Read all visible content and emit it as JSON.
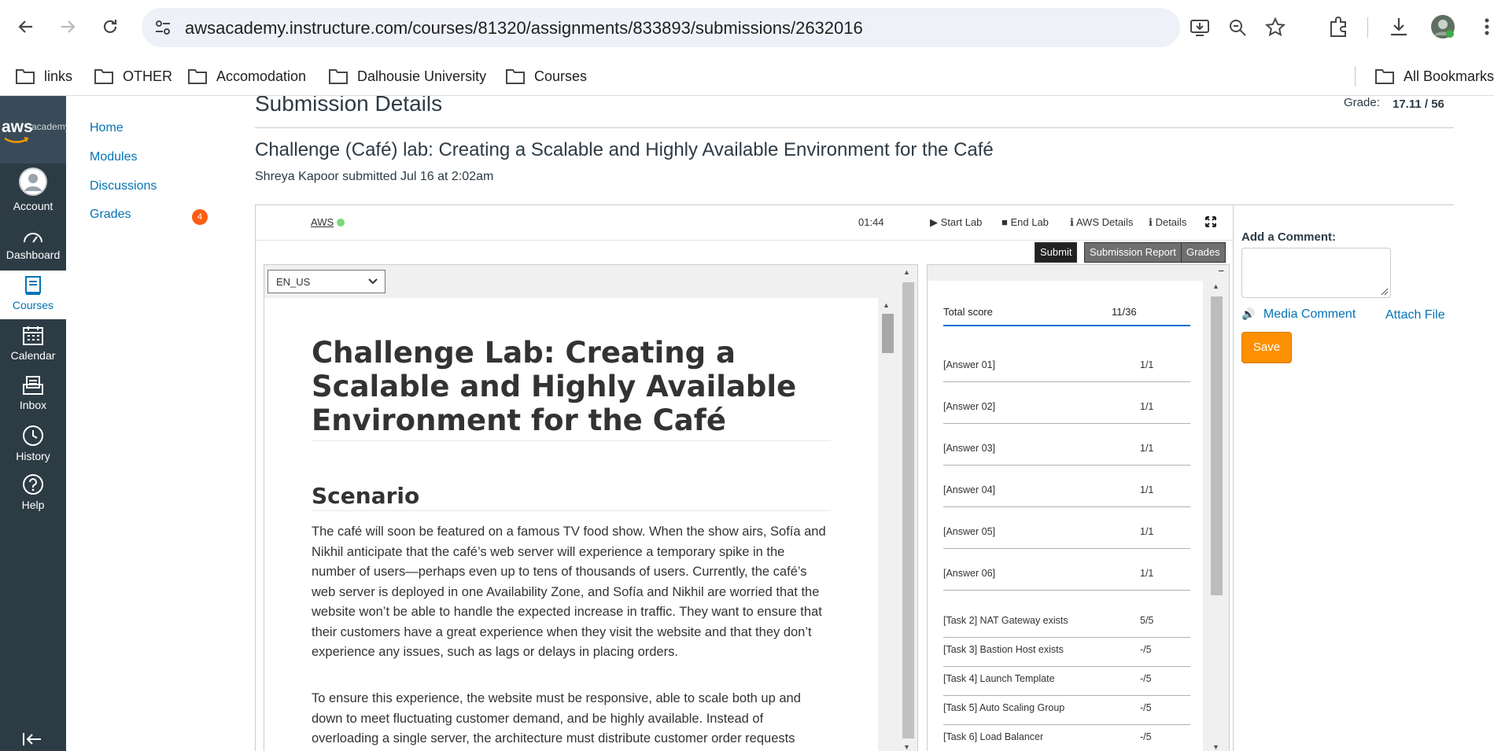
{
  "browser": {
    "url": "awsacademy.instructure.com/courses/81320/assignments/833893/submissions/2632016",
    "bookmarks": [
      "links",
      "OTHER",
      "Accomodation",
      "Dalhousie University",
      "Courses"
    ],
    "all_bookmarks": "All Bookmarks"
  },
  "global_nav": {
    "logo_text": "aws",
    "logo_sub": "academy",
    "items": [
      {
        "label": "Account",
        "icon": "account-icon"
      },
      {
        "label": "Dashboard",
        "icon": "dashboard-icon"
      },
      {
        "label": "Courses",
        "icon": "courses-icon",
        "active": true
      },
      {
        "label": "Calendar",
        "icon": "calendar-icon"
      },
      {
        "label": "Inbox",
        "icon": "inbox-icon"
      },
      {
        "label": "History",
        "icon": "history-icon"
      },
      {
        "label": "Help",
        "icon": "help-icon"
      }
    ]
  },
  "course_nav": {
    "items": [
      "Home",
      "Modules",
      "Discussions",
      "Grades"
    ],
    "grades_badge": "4"
  },
  "submission": {
    "heading": "Submission Details",
    "grade_label": "Grade:",
    "grade_value": "17.11 / 56",
    "assignment_title": "Challenge (Café) lab: Creating a Scalable and Highly Available Environment for the Café",
    "submitted_by": "Shreya Kapoor submitted Jul 16 at 2:02am"
  },
  "lab_bar": {
    "aws_label": "AWS",
    "timer": "01:44",
    "start_lab": "Start Lab",
    "end_lab": "End Lab",
    "aws_details": "AWS Details",
    "details": "Details",
    "submit": "Submit",
    "submission_report": "Submission Report",
    "grades": "Grades",
    "language": "EN_US"
  },
  "lab_content": {
    "title": "Challenge Lab: Creating a Scalable and Highly Available Environment for the Café",
    "scenario_heading": "Scenario",
    "paragraph1": "The café will soon be featured on a famous TV food show. When the show airs, Sofía and Nikhil anticipate that the café’s web server will experience a temporary spike in the number of users—perhaps even up to tens of thousands of users. Currently, the café’s web server is deployed in one Availability Zone, and Sofía and Nikhil are worried that the website won’t be able to handle the expected increase in traffic. They want to ensure that their customers have a great experience when they visit the website and that they don’t experience any issues, such as lags or delays in placing orders.",
    "paragraph2": "To ensure this experience, the website must be responsive, able to scale both up and down to meet fluctuating customer demand, and be highly available. Instead of overloading a single server, the architecture must distribute customer order requests across multiple application servers so it can handle the increase in demand."
  },
  "score_panel": {
    "total_label": "Total score",
    "total_value": "11/36",
    "rows": [
      {
        "label": "[Answer 01]",
        "value": "1/1"
      },
      {
        "label": "[Answer 02]",
        "value": "1/1"
      },
      {
        "label": "[Answer 03]",
        "value": "1/1"
      },
      {
        "label": "[Answer 04]",
        "value": "1/1"
      },
      {
        "label": "[Answer 05]",
        "value": "1/1"
      },
      {
        "label": "[Answer 06]",
        "value": "1/1"
      },
      {
        "label": "[Task 2] NAT Gateway exists",
        "value": "5/5"
      },
      {
        "label": "[Task 3] Bastion Host exists",
        "value": "-/5"
      },
      {
        "label": "[Task 4] Launch Template",
        "value": "-/5"
      },
      {
        "label": "[Task 5] Auto Scaling Group",
        "value": "-/5"
      },
      {
        "label": "[Task 6] Load Balancer",
        "value": "-/5"
      }
    ]
  },
  "comment_panel": {
    "add_comment_label": "Add a Comment:",
    "media_comment": "Media Comment",
    "attach_file": "Attach File",
    "save": "Save"
  },
  "colors": {
    "nav_bg": "#2d3b45",
    "link": "#0374b5",
    "save_button": "#fc9000",
    "badge": "#fc5e13"
  }
}
